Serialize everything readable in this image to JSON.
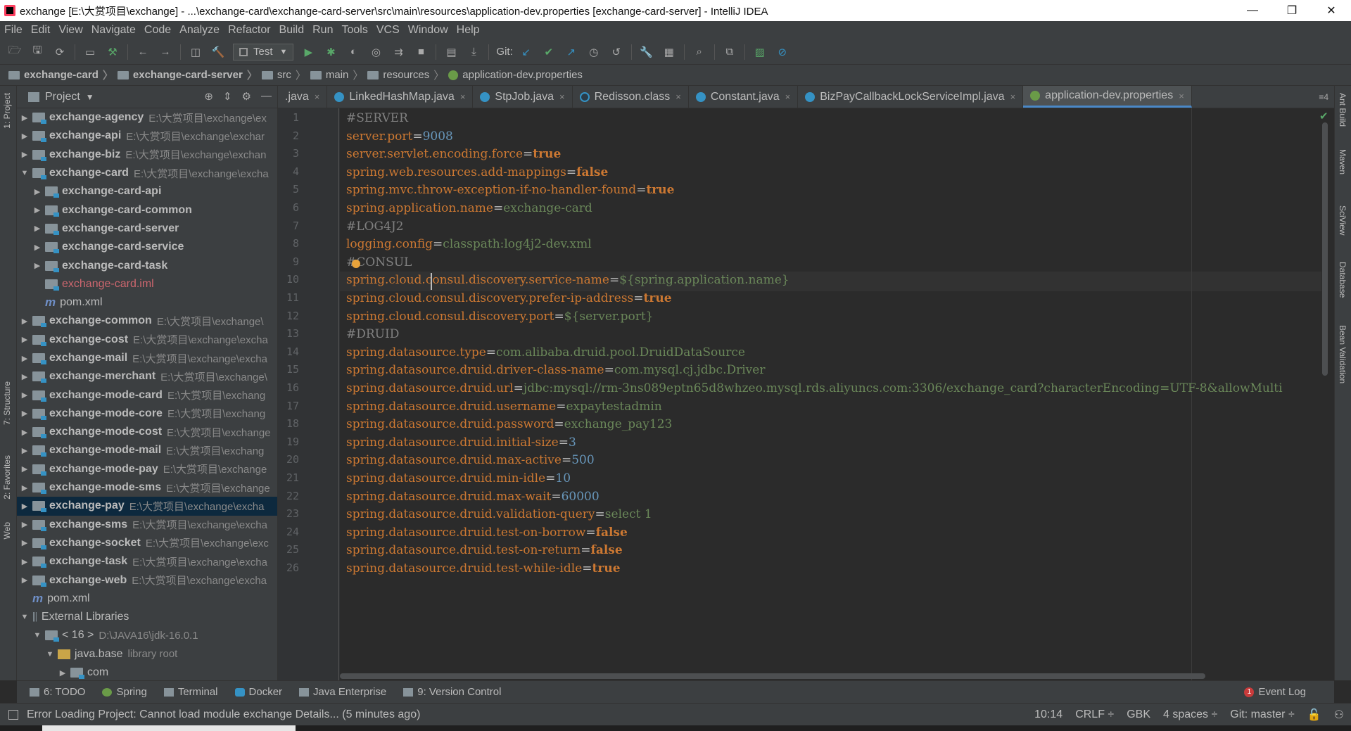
{
  "window": {
    "title": "exchange [E:\\大赏项目\\exchange] - ...\\exchange-card\\exchange-card-server\\src\\main\\resources\\application-dev.properties [exchange-card-server] - IntelliJ IDEA",
    "minimize": "—",
    "restore": "❐",
    "close": "✕"
  },
  "menu": [
    "File",
    "Edit",
    "View",
    "Navigate",
    "Code",
    "Analyze",
    "Refactor",
    "Build",
    "Run",
    "Tools",
    "VCS",
    "Window",
    "Help"
  ],
  "toolbar": {
    "run_config": "Test",
    "git_label": "Git:"
  },
  "breadcrumb": [
    "exchange-card",
    "exchange-card-server",
    "src",
    "main",
    "resources",
    "application-dev.properties"
  ],
  "left_strip": {
    "project": "1: Project",
    "structure": "7: Structure",
    "favorites": "2: Favorites",
    "web": "Web"
  },
  "right_strip": {
    "ant": "Ant Build",
    "maven": "Maven",
    "sciview": "SciView",
    "database": "Database",
    "bean": "Bean Validation"
  },
  "project_panel": {
    "title": "Project",
    "rows": [
      {
        "name": "exchange-agency",
        "path": "E:\\大赏项目\\exchange\\ex",
        "level": 0,
        "arrow": "▶",
        "type": "module",
        "bold": true
      },
      {
        "name": "exchange-api",
        "path": "E:\\大赏项目\\exchange\\exchar",
        "level": 0,
        "arrow": "▶",
        "type": "module",
        "bold": true
      },
      {
        "name": "exchange-biz",
        "path": "E:\\大赏项目\\exchange\\exchan",
        "level": 0,
        "arrow": "▶",
        "type": "module",
        "bold": true
      },
      {
        "name": "exchange-card",
        "path": "E:\\大赏项目\\exchange\\excha",
        "level": 0,
        "arrow": "▼",
        "type": "module",
        "bold": true
      },
      {
        "name": "exchange-card-api",
        "path": "",
        "level": 1,
        "arrow": "▶",
        "type": "module",
        "bold": true
      },
      {
        "name": "exchange-card-common",
        "path": "",
        "level": 1,
        "arrow": "▶",
        "type": "module",
        "bold": true
      },
      {
        "name": "exchange-card-server",
        "path": "",
        "level": 1,
        "arrow": "▶",
        "type": "module",
        "bold": true
      },
      {
        "name": "exchange-card-service",
        "path": "",
        "level": 1,
        "arrow": "▶",
        "type": "module",
        "bold": true
      },
      {
        "name": "exchange-card-task",
        "path": "",
        "level": 1,
        "arrow": "▶",
        "type": "module",
        "bold": true
      },
      {
        "name": "exchange-card.iml",
        "path": "",
        "level": 1,
        "arrow": "",
        "type": "iml",
        "bold": false
      },
      {
        "name": "pom.xml",
        "path": "",
        "level": 1,
        "arrow": "",
        "type": "maven",
        "bold": false
      },
      {
        "name": "exchange-common",
        "path": "E:\\大赏项目\\exchange\\",
        "level": 0,
        "arrow": "▶",
        "type": "module",
        "bold": true
      },
      {
        "name": "exchange-cost",
        "path": "E:\\大赏项目\\exchange\\excha",
        "level": 0,
        "arrow": "▶",
        "type": "module",
        "bold": true
      },
      {
        "name": "exchange-mail",
        "path": "E:\\大赏项目\\exchange\\excha",
        "level": 0,
        "arrow": "▶",
        "type": "module",
        "bold": true
      },
      {
        "name": "exchange-merchant",
        "path": "E:\\大赏项目\\exchange\\",
        "level": 0,
        "arrow": "▶",
        "type": "module",
        "bold": true
      },
      {
        "name": "exchange-mode-card",
        "path": "E:\\大赏项目\\exchang",
        "level": 0,
        "arrow": "▶",
        "type": "module",
        "bold": true
      },
      {
        "name": "exchange-mode-core",
        "path": "E:\\大赏项目\\exchang",
        "level": 0,
        "arrow": "▶",
        "type": "module",
        "bold": true
      },
      {
        "name": "exchange-mode-cost",
        "path": "E:\\大赏项目\\exchange",
        "level": 0,
        "arrow": "▶",
        "type": "module",
        "bold": true
      },
      {
        "name": "exchange-mode-mail",
        "path": "E:\\大赏项目\\exchang",
        "level": 0,
        "arrow": "▶",
        "type": "module",
        "bold": true
      },
      {
        "name": "exchange-mode-pay",
        "path": "E:\\大赏项目\\exchange",
        "level": 0,
        "arrow": "▶",
        "type": "module",
        "bold": true
      },
      {
        "name": "exchange-mode-sms",
        "path": "E:\\大赏项目\\exchange",
        "level": 0,
        "arrow": "▶",
        "type": "module",
        "bold": true
      },
      {
        "name": "exchange-pay",
        "path": "E:\\大赏项目\\exchange\\excha",
        "level": 0,
        "arrow": "▶",
        "type": "module",
        "bold": true,
        "selected": true
      },
      {
        "name": "exchange-sms",
        "path": "E:\\大赏项目\\exchange\\excha",
        "level": 0,
        "arrow": "▶",
        "type": "module",
        "bold": true
      },
      {
        "name": "exchange-socket",
        "path": "E:\\大赏项目\\exchange\\exc",
        "level": 0,
        "arrow": "▶",
        "type": "module",
        "bold": true
      },
      {
        "name": "exchange-task",
        "path": "E:\\大赏项目\\exchange\\excha",
        "level": 0,
        "arrow": "▶",
        "type": "module",
        "bold": true
      },
      {
        "name": "exchange-web",
        "path": "E:\\大赏项目\\exchange\\excha",
        "level": 0,
        "arrow": "▶",
        "type": "module",
        "bold": true
      },
      {
        "name": "pom.xml",
        "path": "",
        "level": 0,
        "arrow": "",
        "type": "maven",
        "bold": false
      },
      {
        "name": "External Libraries",
        "path": "",
        "level": 0,
        "arrow": "▼",
        "type": "lib",
        "bold": false
      },
      {
        "name": "< 16 >",
        "path": "D:\\JAVA16\\jdk-16.0.1",
        "level": 1,
        "arrow": "▼",
        "type": "jdk",
        "bold": false
      },
      {
        "name": "java.base",
        "path": "library root",
        "level": 2,
        "arrow": "▼",
        "type": "yfolder",
        "bold": false
      },
      {
        "name": "com",
        "path": "",
        "level": 3,
        "arrow": "▶",
        "type": "plain",
        "bold": false
      }
    ]
  },
  "tabs": [
    {
      "label": ".java",
      "icon": "none",
      "active": false
    },
    {
      "label": "LinkedHashMap.java",
      "icon": "class",
      "active": false
    },
    {
      "label": "StpJob.java",
      "icon": "class",
      "active": false
    },
    {
      "label": "Redisson.class",
      "icon": "compiled",
      "active": false
    },
    {
      "label": "Constant.java",
      "icon": "class",
      "active": false
    },
    {
      "label": "BizPayCallbackLockServiceImpl.java",
      "icon": "class",
      "active": false
    },
    {
      "label": "application-dev.properties",
      "icon": "props",
      "active": true
    }
  ],
  "tab_overflow": "≡4",
  "editor": {
    "current_line": 10,
    "lines": [
      {
        "n": "1",
        "key": "#SERVER",
        "val": "",
        "type": "comment"
      },
      {
        "n": "2",
        "key": "server.port",
        "val": "9008",
        "type": "num"
      },
      {
        "n": "3",
        "key": "server.servlet.encoding.force",
        "val": "true",
        "type": "bool"
      },
      {
        "n": "4",
        "key": "spring.web.resources.add-mappings",
        "val": "false",
        "type": "bool"
      },
      {
        "n": "5",
        "key": "spring.mvc.throw-exception-if-no-handler-found",
        "val": "true",
        "type": "bool"
      },
      {
        "n": "6",
        "key": "spring.application.name",
        "val": "exchange-card",
        "type": "str"
      },
      {
        "n": "7",
        "key": "#LOG4J2",
        "val": "",
        "type": "comment"
      },
      {
        "n": "8",
        "key": "logging.config",
        "val": "classpath:log4j2-dev.xml",
        "type": "str"
      },
      {
        "n": "9",
        "key": "#CONSUL",
        "val": "",
        "type": "comment"
      },
      {
        "n": "10",
        "key": "spring.cloud.consul.discovery.service-name",
        "val": "${spring.application.name}",
        "type": "str"
      },
      {
        "n": "11",
        "key": "spring.cloud.consul.discovery.prefer-ip-address",
        "val": "true",
        "type": "bool"
      },
      {
        "n": "12",
        "key": "spring.cloud.consul.discovery.port",
        "val": "${server.port}",
        "type": "str"
      },
      {
        "n": "13",
        "key": "#DRUID",
        "val": "",
        "type": "comment"
      },
      {
        "n": "14",
        "key": "spring.datasource.type",
        "val": "com.alibaba.druid.pool.DruidDataSource",
        "type": "str"
      },
      {
        "n": "15",
        "key": "spring.datasource.druid.driver-class-name",
        "val": "com.mysql.cj.jdbc.Driver",
        "type": "str"
      },
      {
        "n": "16",
        "key": "spring.datasource.druid.url",
        "val": "jdbc:mysql://rm-3ns089eptn65d8whzeo.mysql.rds.aliyuncs.com:3306/exchange_card?characterEncoding=UTF-8&allowMulti",
        "type": "str"
      },
      {
        "n": "17",
        "key": "spring.datasource.druid.username",
        "val": "expaytestadmin",
        "type": "str"
      },
      {
        "n": "18",
        "key": "spring.datasource.druid.password",
        "val": "exchange_pay123",
        "type": "str"
      },
      {
        "n": "19",
        "key": "spring.datasource.druid.initial-size",
        "val": "3",
        "type": "num"
      },
      {
        "n": "20",
        "key": "spring.datasource.druid.max-active",
        "val": "500",
        "type": "num"
      },
      {
        "n": "21",
        "key": "spring.datasource.druid.min-idle",
        "val": "10",
        "type": "num"
      },
      {
        "n": "22",
        "key": "spring.datasource.druid.max-wait",
        "val": "60000",
        "type": "num"
      },
      {
        "n": "23",
        "key": "spring.datasource.druid.validation-query",
        "val": "select 1",
        "type": "str"
      },
      {
        "n": "24",
        "key": "spring.datasource.druid.test-on-borrow",
        "val": "false",
        "type": "bool"
      },
      {
        "n": "25",
        "key": "spring.datasource.druid.test-on-return",
        "val": "false",
        "type": "bool"
      },
      {
        "n": "26",
        "key": "spring.datasource.druid.test-while-idle",
        "val": "true",
        "type": "bool"
      }
    ]
  },
  "tool_windows": [
    {
      "label": "6: TODO",
      "icon": "todo"
    },
    {
      "label": "Spring",
      "icon": "spring"
    },
    {
      "label": "Terminal",
      "icon": "terminal"
    },
    {
      "label": "Docker",
      "icon": "docker"
    },
    {
      "label": "Java Enterprise",
      "icon": "javaee"
    },
    {
      "label": "9: Version Control",
      "icon": "vcs"
    }
  ],
  "event_log": {
    "label": "Event Log",
    "count": "1"
  },
  "status": {
    "message": "Error Loading Project: Cannot load module exchange Details... (5 minutes ago)",
    "position": "10:14",
    "line_sep": "CRLF ÷",
    "encoding": "GBK",
    "indent": "4 spaces ÷",
    "git": "Git: master ÷"
  },
  "colors": {
    "keyword": "#cc7832",
    "string": "#6a8759",
    "number": "#6897bb",
    "comment": "#808080",
    "selection": "#0d293e",
    "active_tab_underline": "#4a88c7"
  }
}
